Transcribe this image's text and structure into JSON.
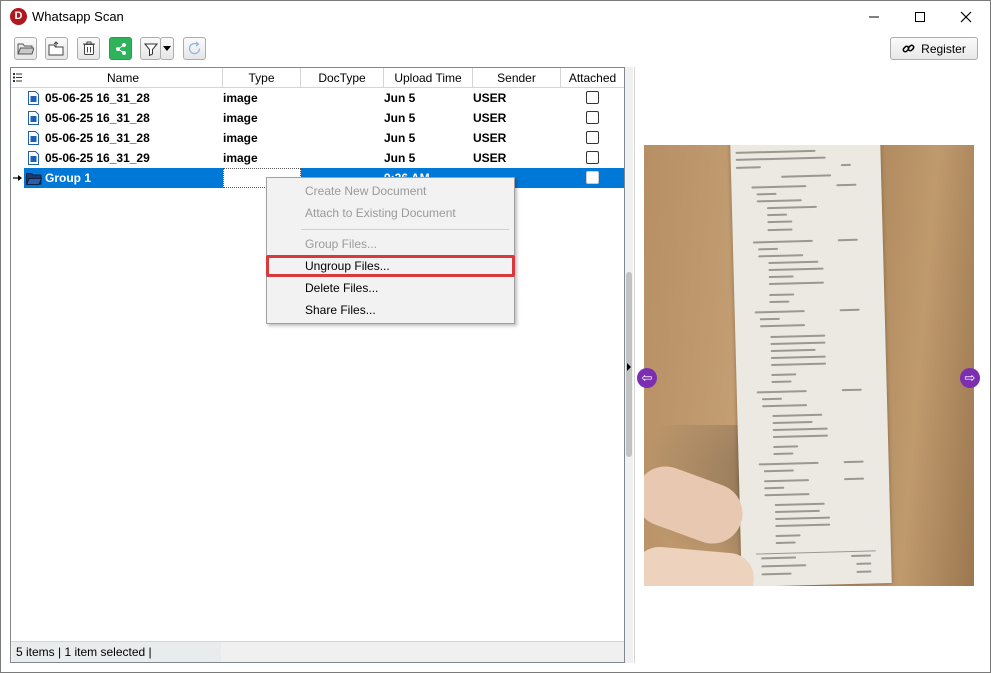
{
  "window": {
    "title": "Whatsapp Scan",
    "app_icon_letter": "D"
  },
  "toolbar": {
    "register_label": "Register",
    "buttons": [
      "open-folder-icon",
      "open-file-icon",
      "delete-icon",
      "share-icon",
      "filter-icon",
      "refresh-icon"
    ]
  },
  "grid": {
    "columns": [
      "Name",
      "Type",
      "DocType",
      "Upload Time",
      "Sender",
      "Attached"
    ],
    "rows": [
      {
        "name": "05-06-25 16_31_28",
        "type": "image",
        "doctype": "",
        "upload_time": "Jun 5",
        "sender": "USER",
        "attached": false
      },
      {
        "name": "05-06-25 16_31_28",
        "type": "image",
        "doctype": "",
        "upload_time": "Jun 5",
        "sender": "USER",
        "attached": false
      },
      {
        "name": "05-06-25 16_31_28",
        "type": "image",
        "doctype": "",
        "upload_time": "Jun 5",
        "sender": "USER",
        "attached": false
      },
      {
        "name": "05-06-25 16_31_29",
        "type": "image",
        "doctype": "",
        "upload_time": "Jun 5",
        "sender": "USER",
        "attached": false
      },
      {
        "name": "Group 1",
        "type": "",
        "doctype": "",
        "upload_time": "9:26 AM",
        "sender": "",
        "attached": false
      }
    ]
  },
  "status": {
    "text": "5 items |  1 item selected |"
  },
  "context_menu": {
    "items": [
      {
        "label": "Create New Document",
        "enabled": false
      },
      {
        "label": "Attach to Existing Document",
        "enabled": false
      },
      {
        "label": "Group Files...",
        "enabled": false
      },
      {
        "label": "Ungroup Files...",
        "enabled": true
      },
      {
        "label": "Delete Files...",
        "enabled": true
      },
      {
        "label": "Share Files...",
        "enabled": true
      }
    ]
  },
  "colors": {
    "selection": "#0078d7",
    "highlight_border": "#d9393d",
    "nav_button": "#7b2fb0",
    "share_green": "#2fb35a"
  }
}
